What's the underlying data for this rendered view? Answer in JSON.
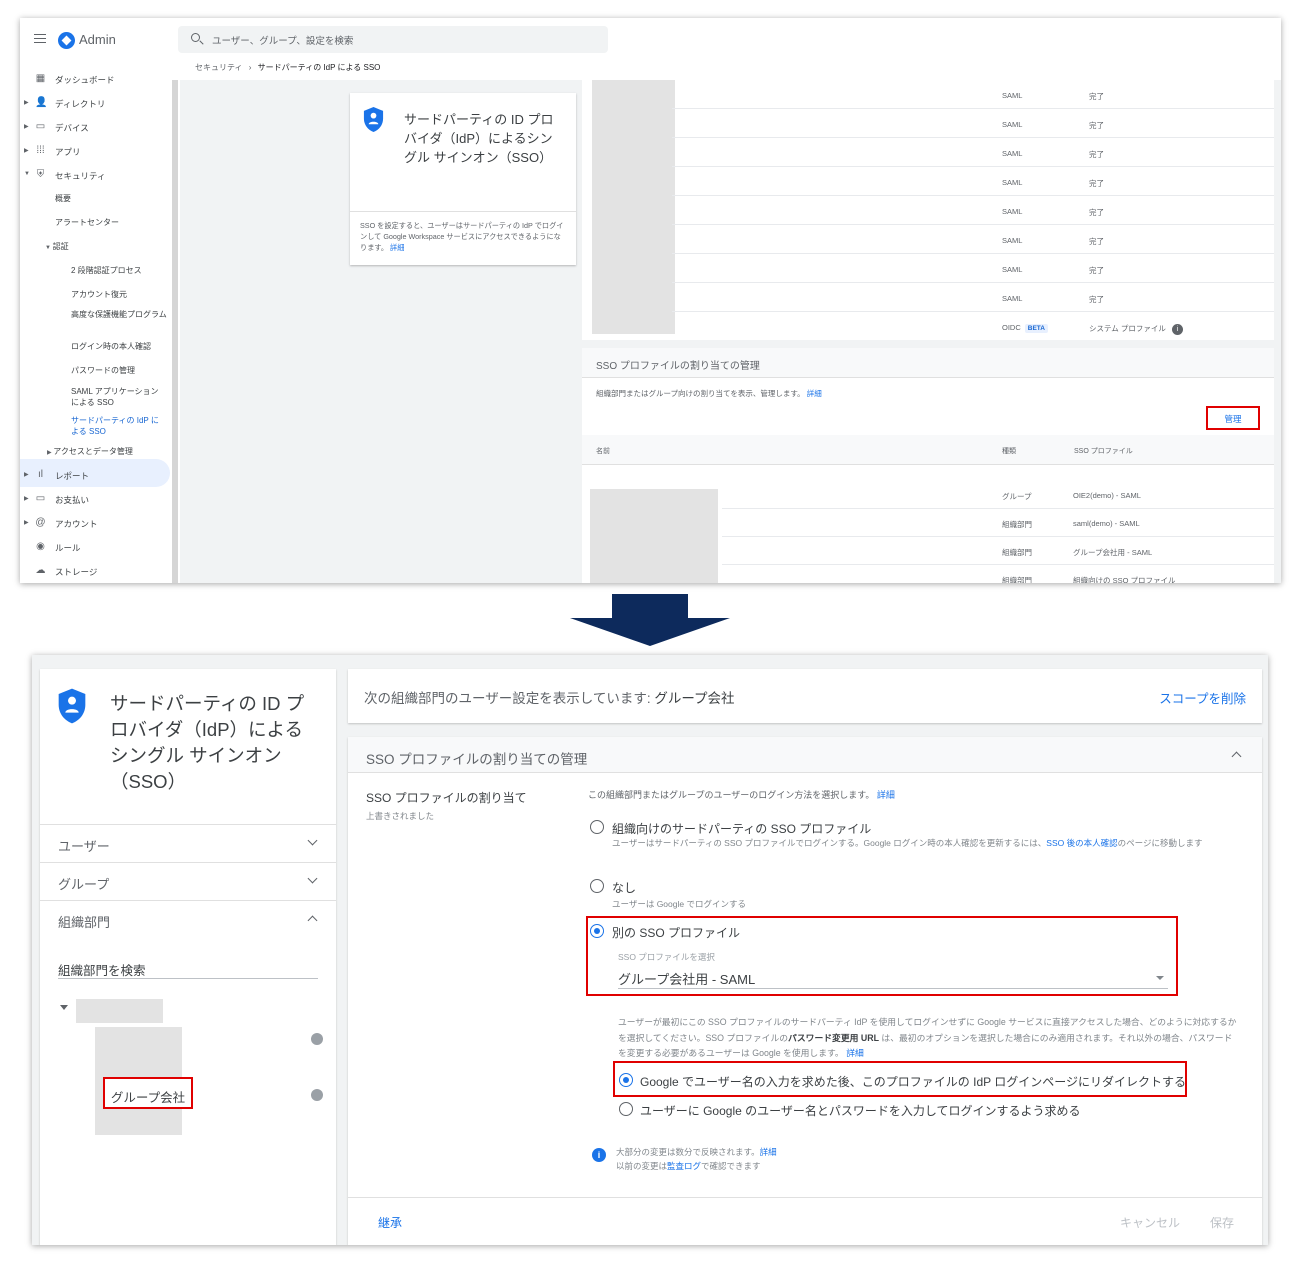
{
  "top": {
    "app_title": "Admin",
    "search_placeholder": "ユーザー、グループ、設定を検索",
    "breadcrumb": {
      "parent": "セキュリティ",
      "separator": "›",
      "current": "サードパーティの IdP による SSO"
    },
    "sidebar": {
      "items": [
        {
          "label": "ダッシュボード",
          "icon": "dashboard-icon"
        },
        {
          "label": "ディレクトリ",
          "icon": "person-icon"
        },
        {
          "label": "デバイス",
          "icon": "devices-icon"
        },
        {
          "label": "アプリ",
          "icon": "apps-grid-icon"
        },
        {
          "label": "セキュリティ",
          "icon": "shield-icon"
        },
        {
          "label": "レポート",
          "icon": "bar-chart-icon"
        },
        {
          "label": "お支払い",
          "icon": "credit-card-icon"
        },
        {
          "label": "アカウント",
          "icon": "at-sign-icon"
        },
        {
          "label": "ルール",
          "icon": "rules-icon"
        },
        {
          "label": "ストレージ",
          "icon": "cloud-icon"
        }
      ],
      "security_sub": [
        "概要",
        "アラートセンター"
      ],
      "auth_label": "認証",
      "auth_sub": [
        "2 段階認証プロセス",
        "アカウント復元",
        "高度な保護機能プログラム",
        "ログイン時の本人確認",
        "パスワードの管理",
        "SAML アプリケーションによる SSO",
        "サードパーティの IdP による SSO"
      ],
      "access_label": "アクセスとデータ管理"
    },
    "card": {
      "title": "サードパーティの ID プロバイダ（IdP）によるシングル サインオン（SSO）",
      "description": "SSO を設定すると、ユーザーはサードパーティの IdP でログインして Google Workspace サービスにアクセスできるようになります。",
      "detail_link": "詳細"
    },
    "profiles": [
      {
        "type": "SAML",
        "status": "完了"
      },
      {
        "type": "SAML",
        "status": "完了"
      },
      {
        "type": "SAML",
        "status": "完了"
      },
      {
        "type": "SAML",
        "status": "完了"
      },
      {
        "type": "SAML",
        "status": "完了"
      },
      {
        "type": "SAML",
        "status": "完了"
      },
      {
        "type": "SAML",
        "status": "完了"
      },
      {
        "type": "SAML",
        "status": "完了"
      },
      {
        "type": "OIDC",
        "badge": "BETA",
        "status": "システム プロファイル"
      }
    ],
    "assign": {
      "title": "SSO プロファイルの割り当ての管理",
      "description": "組織部門またはグループ向けの割り当てを表示、管理します。",
      "detail_link": "詳細",
      "manage_button": "管理",
      "headers": {
        "name": "名前",
        "kind": "種類",
        "profile": "SSO プロファイル"
      },
      "rows": [
        {
          "kind": "グループ",
          "profile": "OIE2(demo) - SAML"
        },
        {
          "kind": "組織部門",
          "profile": "saml(demo) - SAML"
        },
        {
          "kind": "組織部門",
          "profile": "グループ会社用 - SAML"
        },
        {
          "kind": "組織部門",
          "profile": "組織向けの SSO プロファイル"
        }
      ]
    }
  },
  "bottom": {
    "card_title": "サードパーティの ID プロバイダ（IdP）によるシングル サインオン（SSO）",
    "sections": {
      "users": "ユーザー",
      "groups": "グループ",
      "org_units": "組織部門"
    },
    "ou_search_label": "組織部門を検索",
    "selected_ou": "グループ会社",
    "scope": {
      "prefix": "次の組織部門のユーザー設定を表示しています:",
      "name": "グループ会社",
      "remove": "スコープを削除"
    },
    "sso": {
      "panel_title": "SSO プロファイルの割り当ての管理",
      "setting_label": "SSO プロファイルの割り当て",
      "setting_sub": "上書きされました",
      "setting_desc": "この組織部門またはグループのユーザーのログイン方法を選択します。",
      "detail_link": "詳細",
      "option1": {
        "label": "組織向けのサードパーティの SSO プロファイル",
        "desc": "ユーザーはサードパーティの SSO プロファイルでログインする。Google ログイン時の本人確認を更新するには、",
        "link": "SSO 後の本人確認",
        "desc_end": "のページに移動します"
      },
      "option2": {
        "label": "なし",
        "desc": "ユーザーは Google でログインする"
      },
      "option3": {
        "label": "別の SSO プロファイル",
        "select_label": "SSO プロファイルを選択",
        "select_value": "グループ会社用 - SAML"
      },
      "para": {
        "a": "ユーザーが最初にこの SSO プロファイルのサードパーティ IdP を使用してログインせずに Google サービスに直接アクセスした場合、どのように対応するかを選択してください。SSO プロファイルの",
        "bold": "パスワード変更用 URL",
        "b": " は、最初のオプションを選択した場合にのみ適用されます。それ以外の場合、パスワードを変更する必要があるユーザーは Google を使用します。",
        "link": "詳細"
      },
      "redirect1": "Google でユーザー名の入力を求めた後、このプロファイルの IdP ログインページにリダイレクトする",
      "redirect2": "ユーザーに Google のユーザー名とパスワードを入力してログインするよう求める",
      "note_line1": "大部分の変更は数分で反映されます。",
      "note_link1": "詳細",
      "note_line2_a": "以前の変更は",
      "note_link2": "監査ログ",
      "note_line2_b": "で確認できます",
      "inherit": "継承",
      "cancel": "キャンセル",
      "save": "保存"
    }
  },
  "colors": {
    "accent": "#1a73e8",
    "highlight": "#e00000",
    "arrow": "#0d2a5c"
  }
}
